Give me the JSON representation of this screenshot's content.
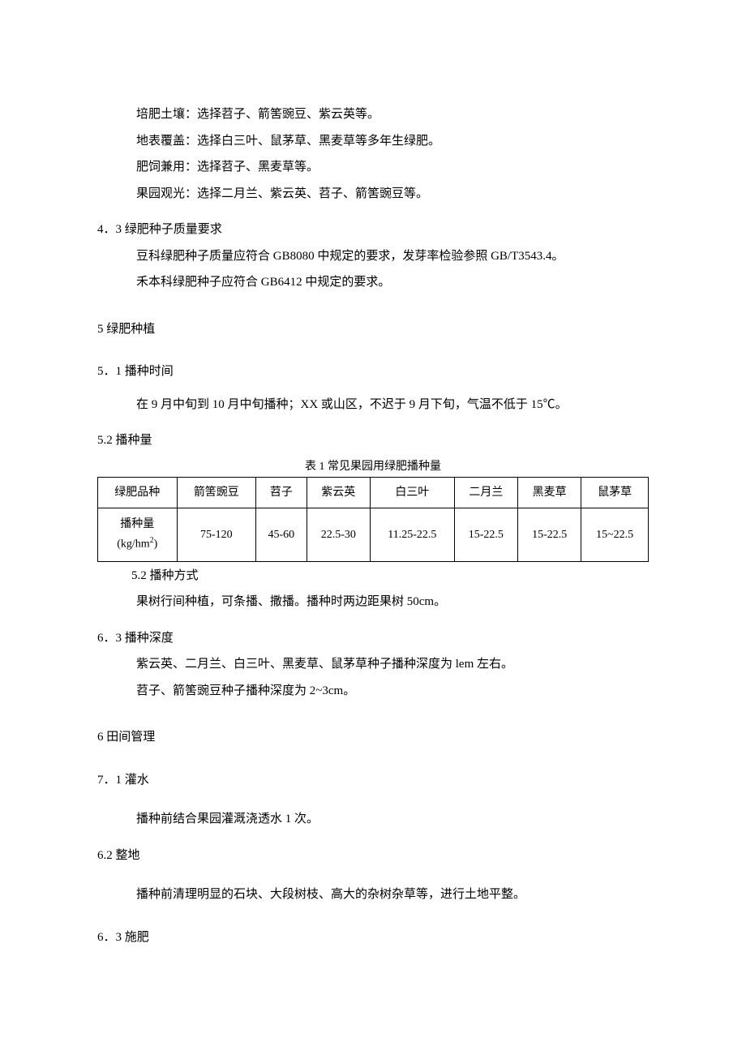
{
  "lines": {
    "l1": "培肥土壤：选择苕子、箭筈豌豆、紫云英等。",
    "l2": "地表覆盖：选择白三叶、鼠茅草、黑麦草等多年生绿肥。",
    "l3": "肥饲兼用：选择苕子、黑麦草等。",
    "l4": "果园观光：选择二月兰、紫云英、苕子、箭筈豌豆等。"
  },
  "s4_3": {
    "title": "4．3 绿肥种子质量要求",
    "p1": "豆科绿肥种子质量应符合 GB8080 中规定的要求，发芽率检验参照 GB/T3543.4。",
    "p2": "禾本科绿肥种子应符合 GB6412 中规定的要求。"
  },
  "s5": {
    "title": "5 绿肥种植"
  },
  "s5_1": {
    "title": "5．1 播种时间",
    "p1": "在 9 月中旬到 10 月中旬播种；XX 或山区，不迟于 9 月下旬，气温不低于 15℃。"
  },
  "s5_2a": {
    "title": "5.2 播种量"
  },
  "table": {
    "caption": "表 1 常见果园用绿肥播种量",
    "header_row": [
      "绿肥品种",
      "箭筈豌豆",
      "苕子",
      "紫云英",
      "白三叶",
      "二月兰",
      "黑麦草",
      "鼠茅草"
    ],
    "data_row_label_line1": "播种量",
    "data_row_label_line2": "(kg/hm",
    "data_row_label_sup": "2",
    "data_row_label_line2_end": ")",
    "data_row": [
      "75-120",
      "45-60",
      "22.5-30",
      "11.25-22.5",
      "15-22.5",
      "15-22.5",
      "15~22.5"
    ]
  },
  "s5_2b": {
    "title": "5.2 播种方式",
    "p1": "果树行间种植，可条播、撒播。播种时两边距果树 50cm。"
  },
  "s6_3a": {
    "title": "6．3 播种深度",
    "p1": "紫云英、二月兰、白三叶、黑麦草、鼠茅草种子播种深度为 lem 左右。",
    "p2": "苕子、箭筈豌豆种子播种深度为 2~3cm。"
  },
  "s6": {
    "title": "6 田间管理"
  },
  "s7_1": {
    "title": "7．1 灌水",
    "p1": "播种前结合果园灌溉浇透水 1 次。"
  },
  "s6_2": {
    "title": "6.2 整地",
    "p1": "播种前清理明显的石块、大段树枝、高大的杂树杂草等，进行土地平整。"
  },
  "s6_3b": {
    "title": "6．3 施肥"
  }
}
